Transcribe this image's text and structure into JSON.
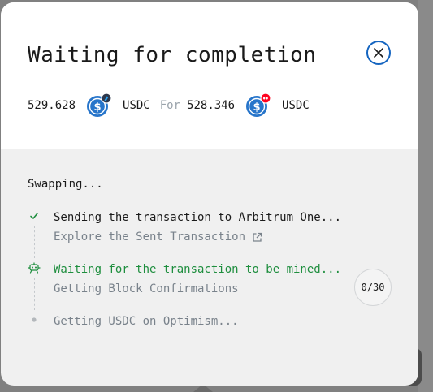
{
  "modal": {
    "title": "Waiting for completion",
    "close_icon": "close-icon"
  },
  "swap": {
    "from_amount": "529.628",
    "from_token": "USDC",
    "from_chain_icon": "arbitrum-badge",
    "for_label": "For",
    "to_amount": "528.346",
    "to_token": "USDC",
    "to_chain_icon": "optimism-badge"
  },
  "status": {
    "heading": "Swapping...",
    "steps": [
      {
        "label": "Sending the transaction to Arbitrum One...",
        "sublabel": "Explore the Sent Transaction",
        "state": "done",
        "icon": "check-icon"
      },
      {
        "label": "Waiting for the transaction to be mined...",
        "sublabel": "Getting Block Confirmations",
        "state": "active",
        "icon": "robot-icon",
        "counter": "0/30"
      },
      {
        "label": "Getting USDC on Optimism...",
        "state": "pending",
        "icon": "dot-icon"
      }
    ]
  },
  "colors": {
    "accent": "#1565c0",
    "active": "#1e8e3e",
    "usdc_blue": "#2775ca",
    "optimism_red": "#ff0420",
    "arbitrum_navy": "#2d374b"
  }
}
